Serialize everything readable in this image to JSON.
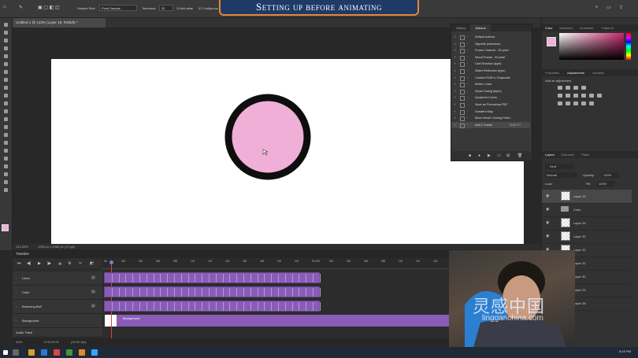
{
  "banner": {
    "title": "Setting up before animating"
  },
  "option_bar": {
    "sample_size_label": "Sample Size:",
    "sample_size_value": "Point Sample",
    "tolerance_label": "Tolerance:",
    "tolerance_value": "32",
    "anti_alias": "Anti-alias",
    "contiguous": "Contiguous"
  },
  "document": {
    "tab_title": "Untitled-1 @ 143% (Layer 19, RGB/8) *",
    "zoom": "143.33%",
    "doc_info": "1920 px x 1080 px (72 ppi)"
  },
  "actions_panel": {
    "tabs": [
      "History",
      "Actions"
    ],
    "active_tab": "Actions",
    "items": [
      {
        "name": "Default Actions",
        "shortcut": ""
      },
      {
        "name": "Vignette (selection)",
        "shortcut": ""
      },
      {
        "name": "Frame Channel - 50 pixel",
        "shortcut": ""
      },
      {
        "name": "Wood Frame - 50 pixel",
        "shortcut": ""
      },
      {
        "name": "Cast Shadow (type)",
        "shortcut": ""
      },
      {
        "name": "Water Reflection (type)",
        "shortcut": ""
      },
      {
        "name": "Custom RGB to Grayscale",
        "shortcut": ""
      },
      {
        "name": "Molten Lead",
        "shortcut": ""
      },
      {
        "name": "Sepia Toning (layer)",
        "shortcut": ""
      },
      {
        "name": "Quadrant Colors",
        "shortcut": ""
      },
      {
        "name": "Save as Photoshop PDF",
        "shortcut": ""
      },
      {
        "name": "Gradient Map",
        "shortcut": ""
      },
      {
        "name": "Mixer Brush Cloning Paint ...",
        "shortcut": ""
      },
      {
        "name": "Add 1 Frame",
        "shortcut": "Shift+F2"
      }
    ]
  },
  "color_panel": {
    "tabs": [
      "Color",
      "Swatches",
      "Gradients",
      "Patterns"
    ],
    "foreground": "#f0b4d8"
  },
  "adjustments_panel": {
    "tabs": [
      "Properties",
      "Adjustments",
      "Libraries"
    ],
    "add_label": "Add an adjustment"
  },
  "layers_panel": {
    "tabs": [
      "Layers",
      "Channels",
      "Paths"
    ],
    "filter": "Kind",
    "blend_mode": "Normal",
    "opacity_label": "Opacity:",
    "opacity": "100%",
    "lock_label": "Lock:",
    "fill_label": "Fill:",
    "fill": "100%",
    "layers": [
      {
        "name": "Layer 19",
        "selected": true,
        "group": false
      },
      {
        "name": "Color",
        "selected": false,
        "group": true
      },
      {
        "name": "Layer 34",
        "selected": false,
        "group": false
      },
      {
        "name": "Layer 33",
        "selected": false,
        "group": false
      },
      {
        "name": "Layer 32",
        "selected": false,
        "group": false
      },
      {
        "name": "Layer 31",
        "selected": false,
        "group": false
      },
      {
        "name": "Layer 30",
        "selected": false,
        "group": false
      },
      {
        "name": "Layer 29",
        "selected": false,
        "group": false
      },
      {
        "name": "Layer 28",
        "selected": false,
        "group": false
      }
    ]
  },
  "timeline": {
    "title": "Timeline",
    "ruler": [
      "00",
      "02f",
      "04f",
      "06f",
      "08f",
      "10f",
      "12f",
      "14f",
      "16f",
      "18f",
      "20f",
      "22f",
      "01:00f",
      "02f",
      "04f",
      "06f",
      "08f",
      "10f",
      "12f",
      "14f",
      "16f",
      "18f",
      "20f"
    ],
    "tracks": [
      "Lines",
      "Color",
      "Bouncing Ball",
      "Background"
    ],
    "background_clip": "Background",
    "audio_track": "Audio Track",
    "timecode": "0:00:00:01",
    "fps": "(24.00 fps)",
    "frame": "0001"
  },
  "watermark": {
    "text": "灵感中国",
    "url": "lingganchina.com"
  },
  "taskbar": {
    "time": "8:15 PM"
  }
}
